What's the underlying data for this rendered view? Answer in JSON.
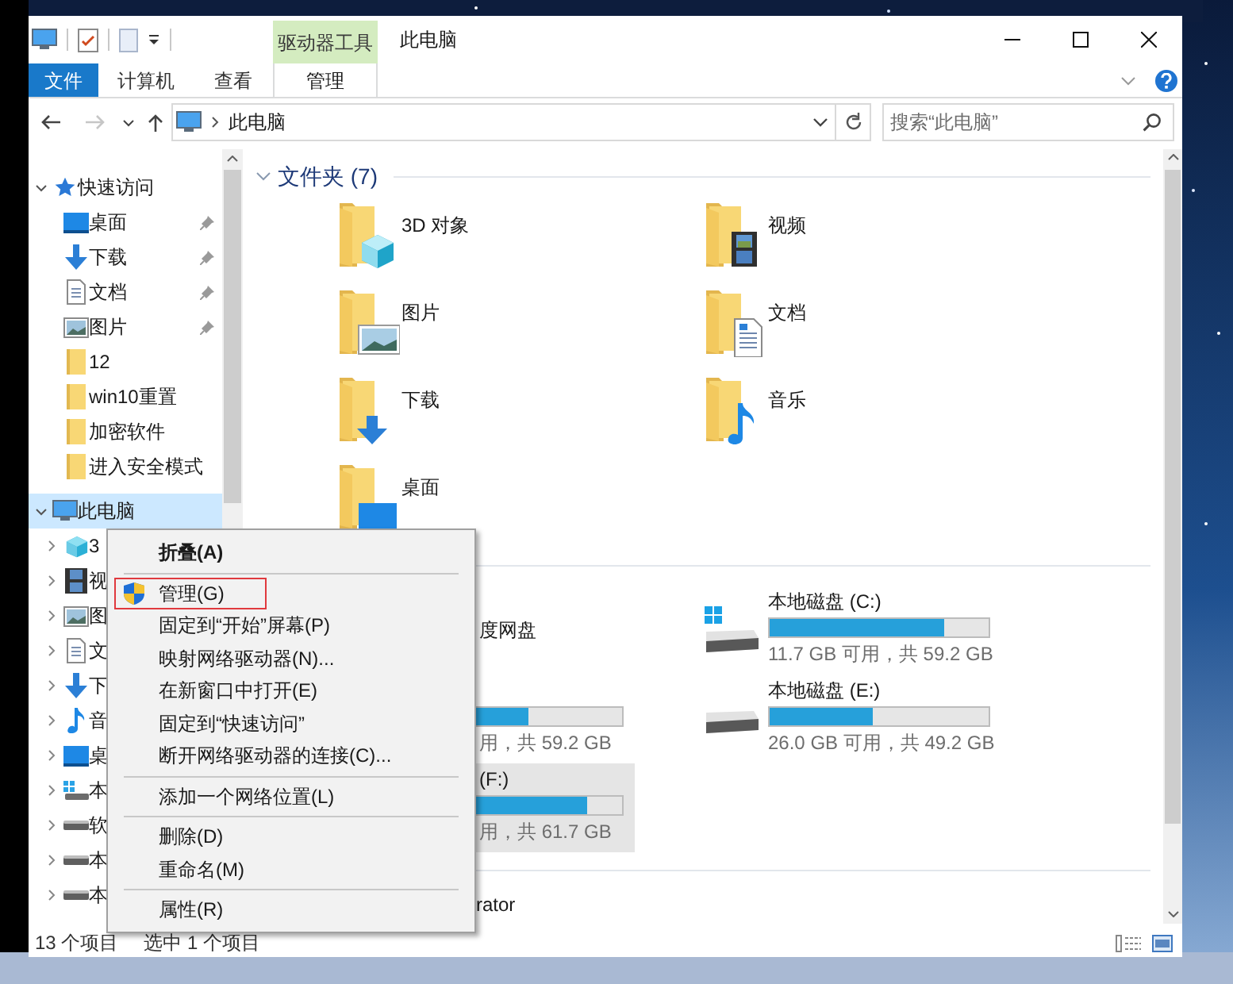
{
  "window": {
    "title": "此电脑",
    "context_group": "驱动器工具"
  },
  "ribbon_tabs": [
    {
      "label": "文件",
      "kind": "file"
    },
    {
      "label": "计算机",
      "kind": "tab"
    },
    {
      "label": "查看",
      "kind": "tab"
    },
    {
      "label": "管理",
      "kind": "context"
    }
  ],
  "nav_buttons": [
    {
      "kind": "back",
      "disabled": false
    },
    {
      "kind": "forward",
      "disabled": true
    },
    {
      "kind": "recent",
      "disabled": false
    },
    {
      "kind": "up",
      "disabled": false
    }
  ],
  "address": {
    "crumbs": [
      "此电脑"
    ]
  },
  "search": {
    "placeholder": "搜索“此电脑”"
  },
  "navigation": [
    {
      "label": "快速访问",
      "kind": "star",
      "selected": false,
      "expanded": true,
      "children": [
        {
          "label": "桌面",
          "kind": "desktop",
          "selected": false,
          "pinned": true
        },
        {
          "label": "下载",
          "kind": "download",
          "selected": false,
          "pinned": true
        },
        {
          "label": "文档",
          "kind": "documents",
          "selected": false,
          "pinned": true
        },
        {
          "label": "图片",
          "kind": "pictures",
          "selected": false,
          "pinned": true
        },
        {
          "label": "12",
          "kind": "folder",
          "selected": false,
          "pinned": false
        },
        {
          "label": "win10重置",
          "kind": "folder",
          "selected": false,
          "pinned": false
        },
        {
          "label": "加密软件",
          "kind": "folder",
          "selected": false,
          "pinned": false
        },
        {
          "label": "进入安全模式",
          "kind": "folder",
          "selected": false,
          "pinned": false
        }
      ]
    },
    {
      "label": "此电脑",
      "kind": "pc",
      "selected": true,
      "expanded": true,
      "children": [
        {
          "label": "3",
          "kind": "cube",
          "selected": false,
          "expanded": false
        },
        {
          "label": "视",
          "kind": "video",
          "selected": false,
          "expanded": false
        },
        {
          "label": "图",
          "kind": "pictures",
          "selected": false,
          "expanded": false
        },
        {
          "label": "文",
          "kind": "documents",
          "selected": false,
          "expanded": false
        },
        {
          "label": "下",
          "kind": "download",
          "selected": false,
          "expanded": false
        },
        {
          "label": "音",
          "kind": "music",
          "selected": false,
          "expanded": false
        },
        {
          "label": "桌",
          "kind": "desktop",
          "selected": false,
          "expanded": false
        },
        {
          "label": "本",
          "kind": "system-drive",
          "selected": false,
          "expanded": false
        },
        {
          "label": "软",
          "kind": "drive",
          "selected": false,
          "expanded": false
        },
        {
          "label": "本",
          "kind": "drive",
          "selected": false,
          "expanded": false
        },
        {
          "label": "本",
          "kind": "drive",
          "selected": false,
          "expanded": false
        }
      ]
    }
  ],
  "folders": {
    "title": "文件夹 (7)",
    "expanded": true,
    "items": [
      {
        "name": "3D 对象",
        "kind": "cube"
      },
      {
        "name": "视频",
        "kind": "video"
      },
      {
        "name": "图片",
        "kind": "pictures"
      },
      {
        "name": "文档",
        "kind": "documents"
      },
      {
        "name": "下载",
        "kind": "download"
      },
      {
        "name": "音乐",
        "kind": "music"
      },
      {
        "name": "桌面",
        "kind": "desktop"
      }
    ]
  },
  "drives": [
    {
      "name": "度网盘",
      "selected": false
    },
    {
      "name": "本地磁盘 (C:)",
      "kind": "system",
      "level": 0.8,
      "space": "11.7 GB 可用，共 59.2 GB",
      "selected": false
    },
    {
      "level": 0.57,
      "space": "用，共 59.2 GB",
      "selected": false
    },
    {
      "name": "本地磁盘 (E:)",
      "kind": "drive",
      "level": 0.47,
      "space": "26.0 GB 可用，共 49.2 GB",
      "selected": false
    },
    {
      "name": "(F:)",
      "level": 0.84,
      "space": "用，共 61.7 GB",
      "selected": true
    }
  ],
  "network": [
    {
      "name": "rator"
    }
  ],
  "status_bar": {
    "count": "13 个项目",
    "selection": "选中 1 个项目"
  },
  "context_menu": [
    {
      "kind": "item",
      "label": "折叠(A)",
      "default": true,
      "highlighted": false
    },
    {
      "kind": "separator"
    },
    {
      "kind": "admin_item",
      "label": "管理(G)",
      "default": false,
      "highlighted": true
    },
    {
      "kind": "item",
      "label": "固定到“开始”屏幕(P)",
      "default": false,
      "highlighted": false
    },
    {
      "kind": "item",
      "label": "映射网络驱动器(N)...",
      "default": false,
      "highlighted": false
    },
    {
      "kind": "item",
      "label": "在新窗口中打开(E)",
      "default": false,
      "highlighted": false
    },
    {
      "kind": "item",
      "label": "固定到“快速访问”",
      "default": false,
      "highlighted": false
    },
    {
      "kind": "item",
      "label": "断开网络驱动器的连接(C)...",
      "default": false,
      "highlighted": false
    },
    {
      "kind": "separator"
    },
    {
      "kind": "item",
      "label": "添加一个网络位置(L)",
      "default": false,
      "highlighted": false
    },
    {
      "kind": "separator"
    },
    {
      "kind": "item",
      "label": "删除(D)",
      "default": false,
      "highlighted": false
    },
    {
      "kind": "item",
      "label": "重命名(M)",
      "default": false,
      "highlighted": false
    },
    {
      "kind": "separator"
    },
    {
      "kind": "item",
      "label": "属性(R)",
      "default": false,
      "highlighted": false
    }
  ]
}
